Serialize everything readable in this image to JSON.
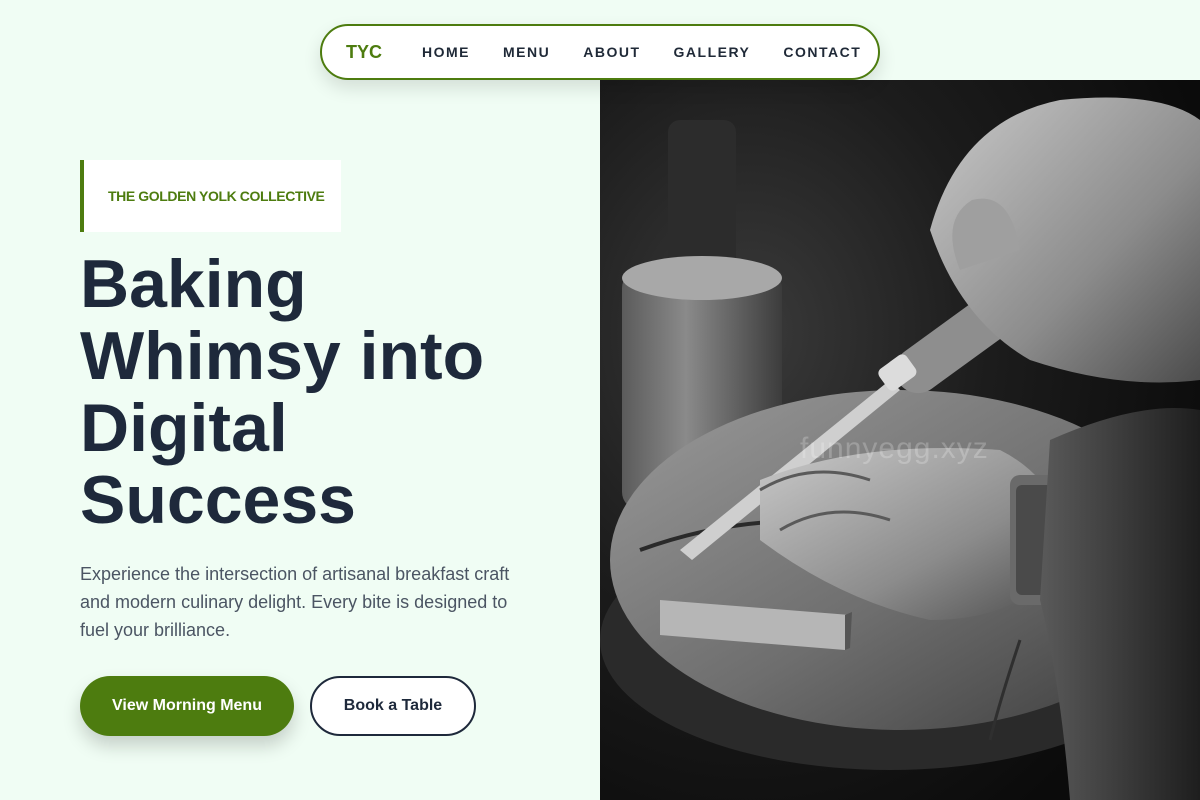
{
  "nav": {
    "brand": "TYC",
    "links": [
      "HOME",
      "MENU",
      "ABOUT",
      "GALLERY",
      "CONTACT"
    ]
  },
  "hero": {
    "eyebrow": "THE GOLDEN YOLK COLLECTIVE",
    "headline": "Baking Whimsy into Digital Success",
    "description": "Experience the intersection of artisanal breakfast craft and modern culinary delight. Every bite is designed to fuel your brilliance.",
    "primary_cta": "View Morning Menu",
    "secondary_cta": "Book a Table",
    "image_watermark": "funnyegg.xyz"
  },
  "colors": {
    "background": "#f0fdf4",
    "accent": "#4d7c0f",
    "heading": "#1e293b"
  }
}
